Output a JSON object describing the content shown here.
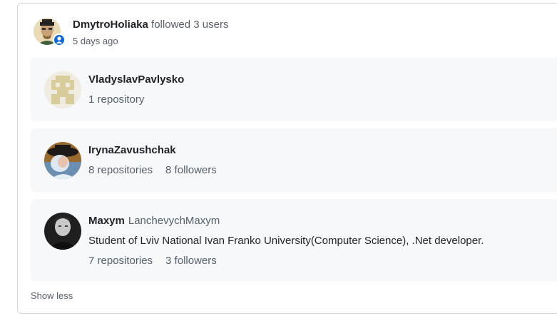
{
  "event": {
    "actor": "DmytroHoliaka",
    "action": "followed 3 users",
    "time": "5 days ago",
    "badge_icon": "person-icon",
    "accent_color": "#0969da"
  },
  "users": [
    {
      "name": "VladyslavPavlysko",
      "login": "",
      "bio": "",
      "repositories": "1 repository",
      "followers": ""
    },
    {
      "name": "IrynaZavushchak",
      "login": "",
      "bio": "",
      "repositories": "8 repositories",
      "followers": "8 followers"
    },
    {
      "name": "Maxym",
      "login": "LanchevychMaxym",
      "bio": "Student of Lviv National Ivan Franko University(Computer Science), .Net developer.",
      "repositories": "7 repositories",
      "followers": "3 followers"
    }
  ],
  "show_less_label": "Show less"
}
